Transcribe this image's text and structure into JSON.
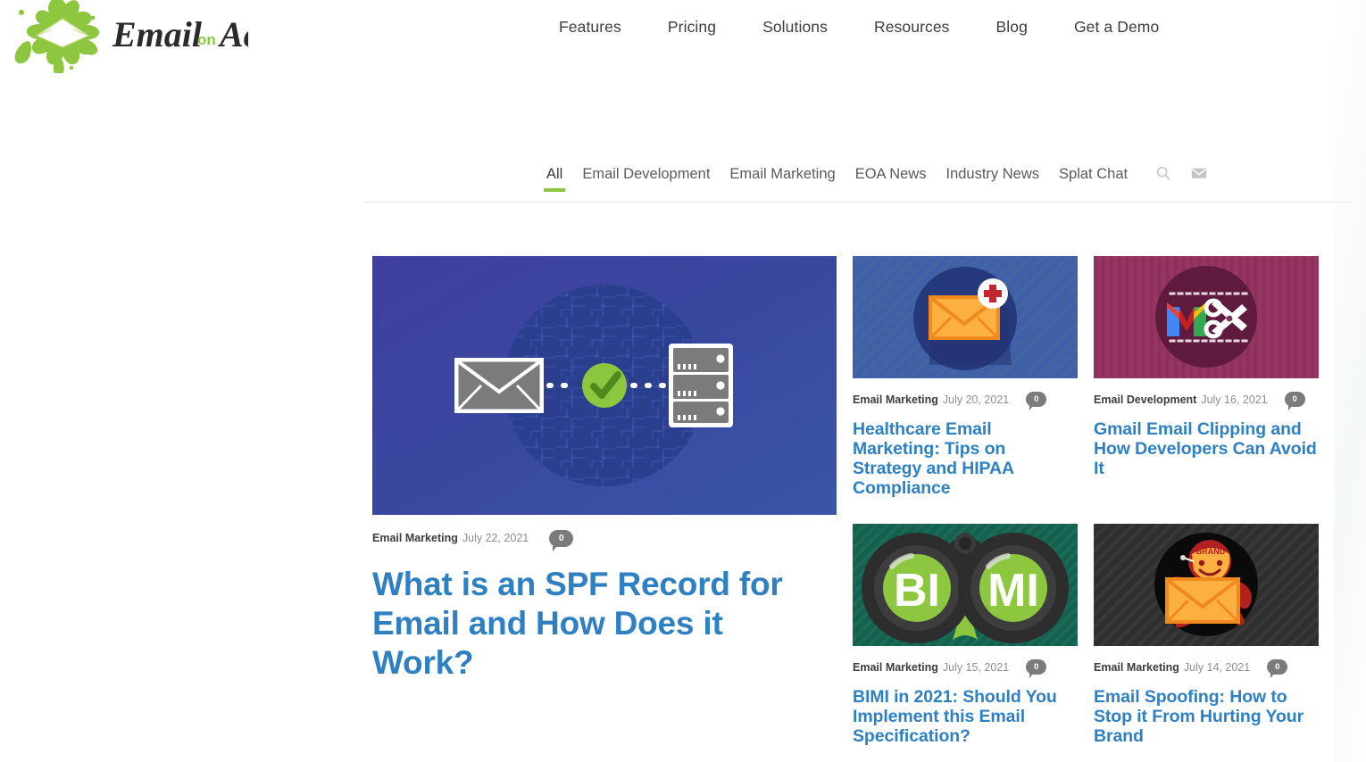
{
  "site": {
    "logo_text_email": "Email",
    "logo_text_on": "on",
    "logo_text_acid": "Acid",
    "logo_alt": "Email on Acid",
    "brand_green": "#8dc63f",
    "link_blue": "#2f80c2"
  },
  "nav": {
    "items": [
      {
        "label": "Features"
      },
      {
        "label": "Pricing"
      },
      {
        "label": "Solutions"
      },
      {
        "label": "Resources"
      },
      {
        "label": "Blog"
      },
      {
        "label": "Get a Demo"
      }
    ]
  },
  "tabs": {
    "items": [
      {
        "label": "All",
        "active": true
      },
      {
        "label": "Email Development",
        "active": false
      },
      {
        "label": "Email Marketing",
        "active": false
      },
      {
        "label": "EOA News",
        "active": false
      },
      {
        "label": "Industry News",
        "active": false
      },
      {
        "label": "Splat Chat",
        "active": false
      }
    ],
    "search_icon": "search-icon",
    "mail_icon": "envelope-icon"
  },
  "featured_post": {
    "category": "Email Marketing",
    "date": "July 22, 2021",
    "comments": "0",
    "title": "What is an SPF Record for Email and How Does it Work?",
    "image_alt": "Envelope connected by dotted line to green checkmark and server rack on blue background"
  },
  "posts": [
    {
      "category": "Email Marketing",
      "date": "July 20, 2021",
      "comments": "0",
      "title": "Healthcare Email Marketing: Tips on Strategy and HIPAA Compliance",
      "image_alt": "Orange envelope with red medical cross badge on blue circle"
    },
    {
      "category": "Email Development",
      "date": "July 16, 2021",
      "comments": "0",
      "title": "Gmail Email Clipping and How Developers Can Avoid It",
      "image_alt": "Gmail M logo with white scissors and dotted cut lines on magenta background"
    },
    {
      "category": "Email Marketing",
      "date": "July 15, 2021",
      "comments": "0",
      "title": "BIMI in 2021: Should You Implement this Email Specification?",
      "image_alt": "Binoculars with green lenses showing letters BI and MI on green background"
    },
    {
      "category": "Email Marketing",
      "date": "July 14, 2021",
      "comments": "0",
      "title": "Email Spoofing: How to Stop it From Hurting Your Brand",
      "image_alt": "Red figure wearing a BRAND mask carrying an orange envelope on black circle",
      "mask_label": "BRAND"
    }
  ]
}
